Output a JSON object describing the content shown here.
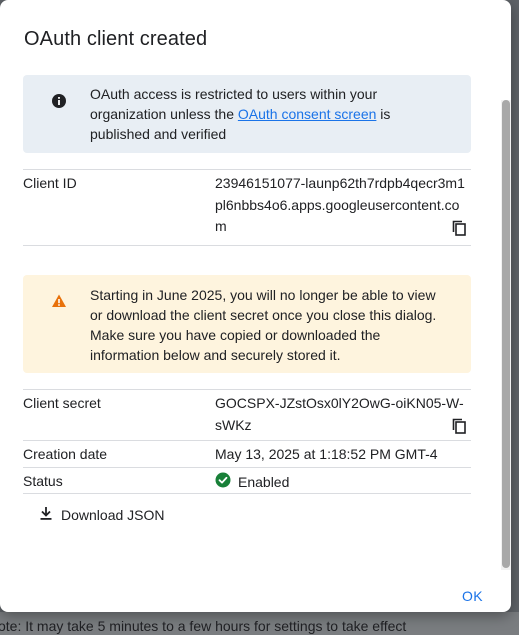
{
  "dialog": {
    "title": "OAuth client created",
    "info": {
      "text_before": "OAuth access is restricted to users within your organization unless the ",
      "link_text": "OAuth consent screen",
      "text_after": " is published and verified"
    },
    "client_id": {
      "label": "Client ID",
      "value": "23946151077-launp62th7rdpb4qecr3m1pl6nbbs4o6.apps.googleusercontent.com"
    },
    "warning": {
      "text": "Starting in June 2025, you will no longer be able to view or download the client secret once you close this dialog. Make sure you have copied or downloaded the information below and securely stored it."
    },
    "client_secret": {
      "label": "Client secret",
      "value": "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"
    },
    "creation_date": {
      "label": "Creation date",
      "value": "May 13, 2025 at 1:18:52 PM GMT-4"
    },
    "status": {
      "label": "Status",
      "value": "Enabled",
      "color": "#188038"
    },
    "download_label": "Download JSON",
    "ok_label": "OK"
  },
  "background": {
    "note": "ote: It may take 5 minutes to a few hours for settings to take effect"
  },
  "colors": {
    "accent": "#1a73e8",
    "info_bg": "#e8eef4",
    "warning_bg": "#fef4de",
    "warning_icon": "#e8710a"
  }
}
